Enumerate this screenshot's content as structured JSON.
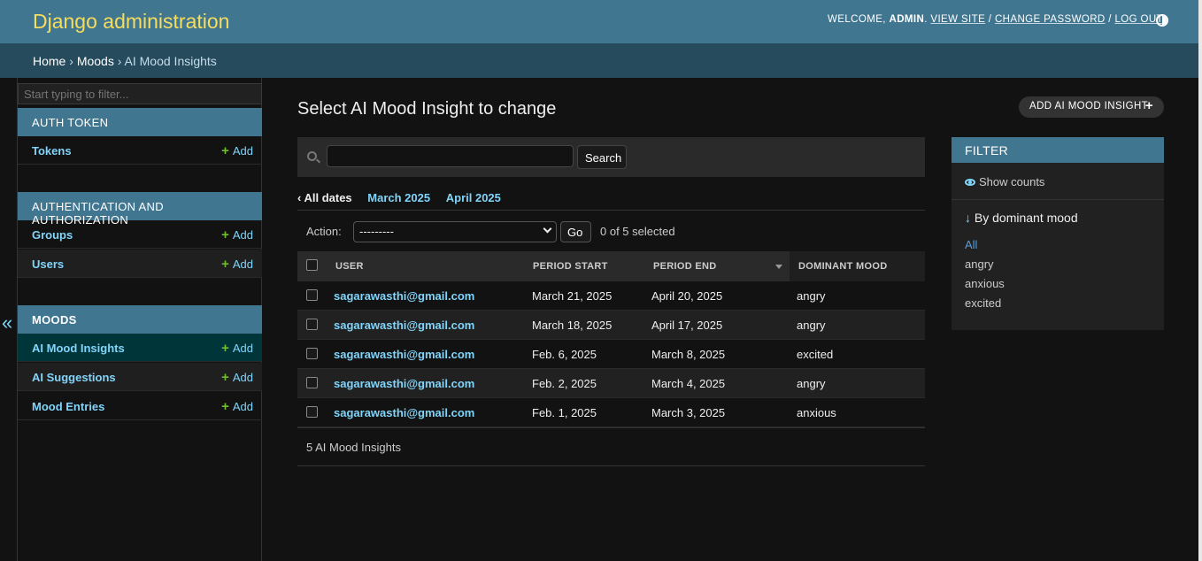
{
  "header": {
    "brand": "Django administration",
    "welcome": "WELCOME,",
    "username": "ADMIN",
    "view_site": "VIEW SITE",
    "change_password": "CHANGE PASSWORD",
    "log_out": "LOG OUT",
    "sep": "/"
  },
  "breadcrumbs": {
    "home": "Home",
    "app": "Moods",
    "current": "AI Mood Insights",
    "sep": "›"
  },
  "sidebar": {
    "filter_placeholder": "Start typing to filter...",
    "collapse": "«",
    "add_label": "Add",
    "apps": [
      {
        "name": "AUTH TOKEN",
        "models": [
          {
            "name": "Tokens"
          }
        ]
      },
      {
        "name": "AUTHENTICATION AND AUTHORIZATION",
        "models": [
          {
            "name": "Groups"
          },
          {
            "name": "Users"
          }
        ]
      },
      {
        "name": "MOODS",
        "models": [
          {
            "name": "AI Mood Insights"
          },
          {
            "name": "AI Suggestions"
          },
          {
            "name": "Mood Entries"
          }
        ]
      }
    ]
  },
  "content": {
    "title": "Select AI Mood Insight to change",
    "add_button": "ADD AI MOOD INSIGHT",
    "search_button": "Search",
    "date_hierarchy": {
      "all": "All dates",
      "links": [
        "March 2025",
        "April 2025"
      ]
    },
    "action_label": "Action:",
    "action_selected": "---------",
    "go_button": "Go",
    "selected_count": "0 of 5 selected",
    "columns": [
      "USER",
      "PERIOD START",
      "PERIOD END",
      "DOMINANT MOOD"
    ],
    "rows": [
      {
        "user": "sagarawasthi@gmail.com",
        "start": "March 21, 2025",
        "end": "April 20, 2025",
        "mood": "angry"
      },
      {
        "user": "sagarawasthi@gmail.com",
        "start": "March 18, 2025",
        "end": "April 17, 2025",
        "mood": "angry"
      },
      {
        "user": "sagarawasthi@gmail.com",
        "start": "Feb. 6, 2025",
        "end": "March 8, 2025",
        "mood": "excited"
      },
      {
        "user": "sagarawasthi@gmail.com",
        "start": "Feb. 2, 2025",
        "end": "March 4, 2025",
        "mood": "angry"
      },
      {
        "user": "sagarawasthi@gmail.com",
        "start": "Feb. 1, 2025",
        "end": "March 3, 2025",
        "mood": "anxious"
      }
    ],
    "paginator": "5 AI Mood Insights"
  },
  "filter": {
    "title": "FILTER",
    "show_counts": "Show counts",
    "by_title": "By dominant mood",
    "options": [
      "All",
      "angry",
      "anxious",
      "excited"
    ]
  },
  "colors": {
    "header": "#417690",
    "breadcrumbs": "#264b5d",
    "brand": "#f5dd5d",
    "link": "#81d4fa",
    "add_plus": "#70bf2b",
    "current_row": "#00363a"
  }
}
